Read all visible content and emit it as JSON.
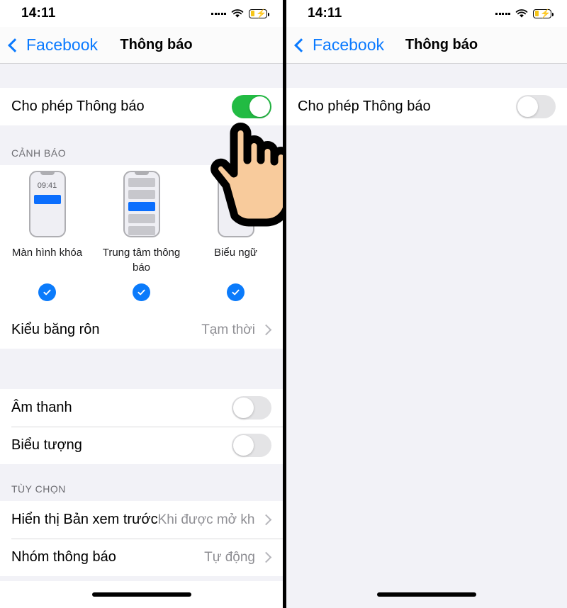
{
  "left_screen": {
    "statusbar": {
      "time": "14:11",
      "cellular_icon": "signal-dots-icon",
      "wifi_icon": "wifi-icon",
      "battery_icon": "battery-charging-icon",
      "battery_color": "#f5c518"
    },
    "navbar": {
      "back_label": "Facebook",
      "back_icon": "chevron-left-icon",
      "title": "Thông báo"
    },
    "allow_row": {
      "label": "Cho phép Thông báo",
      "toggle_state": "on",
      "toggle_color": "#22bb43"
    },
    "alerts_section": {
      "header": "CẢNH BÁO",
      "options": [
        {
          "label": "Màn hình khóa",
          "mock": "lock-screen",
          "mock_time": "09:41",
          "selected": true
        },
        {
          "label": "Trung tâm thông báo",
          "mock": "notification-center",
          "selected": true
        },
        {
          "label": "Biểu ngữ",
          "mock": "banner",
          "selected": true
        }
      ],
      "check_color": "#0b7bfb"
    },
    "banner_style_row": {
      "label": "Kiểu băng rôn",
      "value": "Tạm thời",
      "chevron": "chevron-right-icon"
    },
    "sound_row": {
      "label": "Âm thanh",
      "toggle_state": "off"
    },
    "badge_row": {
      "label": "Biểu tượng",
      "toggle_state": "off"
    },
    "options_section": {
      "header": "TÙY CHỌN",
      "rows": [
        {
          "label": "Hiển thị Bản xem trước",
          "value": "Khi được mở khó...",
          "chevron": "chevron-right-icon"
        },
        {
          "label": "Nhóm thông báo",
          "value": "Tự động",
          "chevron": "chevron-right-icon"
        }
      ]
    },
    "cursor": {
      "icon": "pointing-hand-cursor",
      "skin_color": "#f8cb9c"
    },
    "home_indicator": "home-indicator"
  },
  "right_screen": {
    "statusbar": {
      "time": "14:11",
      "cellular_icon": "signal-dots-icon",
      "wifi_icon": "wifi-icon",
      "battery_icon": "battery-charging-icon",
      "battery_color": "#f5c518"
    },
    "navbar": {
      "back_label": "Facebook",
      "back_icon": "chevron-left-icon",
      "title": "Thông báo"
    },
    "allow_row": {
      "label": "Cho phép Thông báo",
      "toggle_state": "off"
    },
    "home_indicator": "home-indicator"
  }
}
